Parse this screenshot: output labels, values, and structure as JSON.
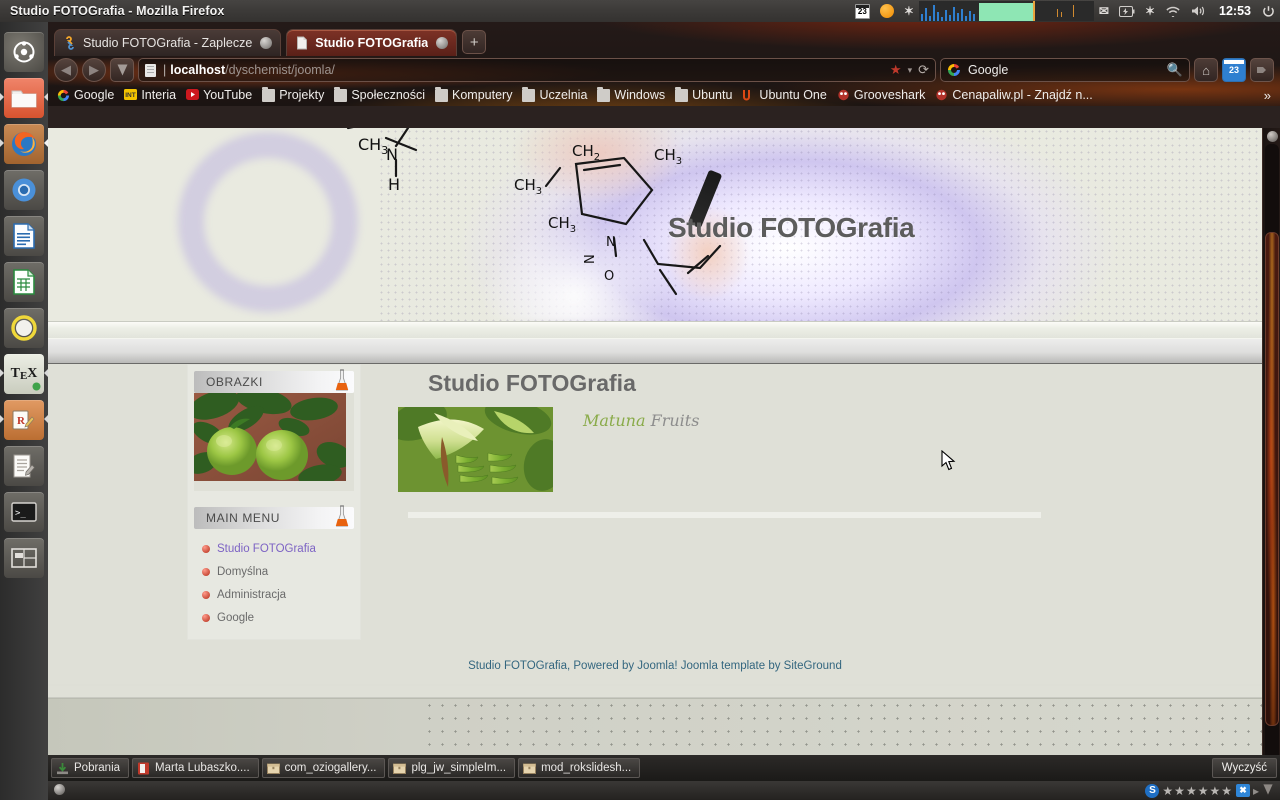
{
  "window": {
    "title": "Studio FOTOGrafia - Mozilla Firefox"
  },
  "top_panel": {
    "clock": "12:53",
    "indicators": [
      {
        "name": "calendar-indicator",
        "label": "23"
      },
      {
        "name": "weather-indicator",
        "label": ""
      },
      {
        "name": "bluetooth-indicator",
        "label": "✶"
      },
      {
        "name": "cpu-monitor-indicator",
        "label": ""
      },
      {
        "name": "memory-monitor-indicator",
        "label": ""
      },
      {
        "name": "net-monitor-indicator",
        "label": ""
      },
      {
        "name": "messaging-indicator",
        "label": "✉"
      },
      {
        "name": "battery-indicator",
        "label": ""
      },
      {
        "name": "bluetooth-status-indicator",
        "label": "✶"
      },
      {
        "name": "network-indicator",
        "label": ""
      },
      {
        "name": "volume-indicator",
        "label": "🔊"
      }
    ],
    "session_icon": "power-icon"
  },
  "launcher": {
    "items": [
      {
        "name": "dash-home",
        "label": "Ubuntu Dash Home"
      },
      {
        "name": "files-nautilus",
        "label": "Files"
      },
      {
        "name": "firefox",
        "label": "Firefox Web Browser"
      },
      {
        "name": "chromium",
        "label": "Chromium Web Browser"
      },
      {
        "name": "libreoffice-writer",
        "label": "LibreOffice Writer"
      },
      {
        "name": "libreoffice-calc",
        "label": "LibreOffice Calc"
      },
      {
        "name": "ubuntu-one",
        "label": "Ubuntu One"
      },
      {
        "name": "texmaker",
        "label": "TeX"
      },
      {
        "name": "notes-editor",
        "label": "Notes"
      },
      {
        "name": "text-editor",
        "label": "Text Editor"
      },
      {
        "name": "terminal",
        "label": "Terminal"
      },
      {
        "name": "workspace-switcher",
        "label": "Workspace Switcher"
      }
    ]
  },
  "browser": {
    "tabs": [
      {
        "label": "Studio FOTOGrafia - Zaplecze",
        "active": false,
        "favicon": "joomla-icon"
      },
      {
        "label": "Studio FOTOGrafia",
        "active": true,
        "favicon": "page-icon"
      }
    ],
    "new_tab_label": "+",
    "nav": {
      "back": "◀",
      "forward": "▶",
      "menu": "▼"
    },
    "url": {
      "separator": "|",
      "host": "localhost",
      "path": "/dyschemist/joomla/"
    },
    "url_actions": {
      "star": "★",
      "caret": "▾",
      "reload": "⟳"
    },
    "search": {
      "engine": "Google",
      "value": "Google",
      "placeholder": "Google",
      "magnifier": "🔍"
    },
    "toolbar_buttons": [
      {
        "name": "home-button",
        "label": "⌂"
      },
      {
        "name": "calendar-button",
        "label": "23"
      },
      {
        "name": "addon-button",
        "label": "▾"
      }
    ],
    "bookmarks": [
      {
        "label": "Google",
        "icon": "google-icon"
      },
      {
        "label": "Interia",
        "icon": "interia-icon"
      },
      {
        "label": "YouTube",
        "icon": "youtube-icon"
      },
      {
        "label": "Projekty",
        "icon": "folder-icon"
      },
      {
        "label": "Społeczności",
        "icon": "folder-icon"
      },
      {
        "label": "Komputery",
        "icon": "folder-icon"
      },
      {
        "label": "Uczelnia",
        "icon": "folder-icon"
      },
      {
        "label": "Windows",
        "icon": "folder-icon"
      },
      {
        "label": "Ubuntu",
        "icon": "folder-icon"
      },
      {
        "label": "Ubuntu One",
        "icon": "ubuntu-one-icon"
      },
      {
        "label": "Grooveshark",
        "icon": "grooveshark-icon"
      },
      {
        "label": "Cenapaliw.pl - Znajdź n...",
        "icon": "site-icon"
      }
    ],
    "bookmarks_overflow": "»"
  },
  "page": {
    "banner": {
      "site_title": "Studio FOTOGrafia",
      "formulas": [
        "CH3",
        "N",
        "H",
        "CH2",
        "CH3",
        "CH3",
        "CH3",
        "N",
        "N",
        "O"
      ]
    },
    "title": "Studio FOTOGrafia",
    "sidebar": {
      "modules": [
        {
          "name": "obrazki-module",
          "title": "OBRAZKI",
          "icon": "flask-icon",
          "thumbnail_alt": "green apples on tree"
        },
        {
          "name": "main-menu-module",
          "title": "MAIN MENU",
          "icon": "flask-icon",
          "items": [
            {
              "label": "Studio FOTOGrafia",
              "visited": true
            },
            {
              "label": "Domyślna",
              "visited": false
            },
            {
              "label": "Administracja",
              "visited": false
            },
            {
              "label": "Google",
              "visited": false
            }
          ]
        }
      ]
    },
    "slideshow": {
      "caption_primary": "Matuna",
      "caption_secondary": "Fruits",
      "image_alt": "green bananas bunch"
    },
    "footer": "Studio FOTOGrafia, Powered by Joomla! Joomla template by SiteGround"
  },
  "taskbar": {
    "items": [
      {
        "label": "Pobrania",
        "icon": "download-icon"
      },
      {
        "label": "Marta Lubaszko....",
        "icon": "pdf-icon"
      },
      {
        "label": "com_oziogallery...",
        "icon": "archive-icon"
      },
      {
        "label": "plg_jw_simpleIm...",
        "icon": "archive-icon"
      },
      {
        "label": "mod_rokslidesh...",
        "icon": "archive-icon"
      }
    ],
    "clear_label": "Wyczyść"
  },
  "status_bar": {
    "skype_icon": "S",
    "stars": "★★★★★★",
    "x_label": "✖",
    "expand": "▸"
  },
  "colors": {
    "accent_red": "#b32c18",
    "link_visited": "#7d63c4",
    "footer_text": "#33667f",
    "page_bg": "#dfe0d7",
    "caption_green": "#8aab4a"
  }
}
